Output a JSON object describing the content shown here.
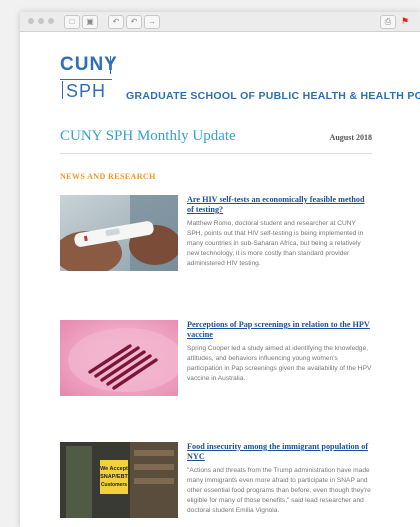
{
  "logo": {
    "line1": "CUNY",
    "line2": "SPH"
  },
  "school_name": "GRADUATE SCHOOL OF PUBLIC HEALTH & HEALTH POLICY",
  "newsletter": {
    "title": "CUNY SPH Monthly Update",
    "date": "August 2018"
  },
  "section_heading": "NEWS AND RESEARCH",
  "toolbar": {
    "icons": [
      "trash-icon",
      "archive-icon",
      "reply-icon",
      "reply-all-icon",
      "forward-icon",
      "print-icon",
      "flag-icon"
    ]
  },
  "articles": [
    {
      "title": "Are HIV self-tests an economically feasible method of testing?",
      "body": "Matthew Romo, doctoral student and researcher at CUNY SPH, points out that HIV self-testing is being implemented in many countries in sub-Saharan Africa, but being a relatively new technology, it is more costly than standard provider administered HIV testing."
    },
    {
      "title": "Perceptions of Pap screenings in relation to the HPV vaccine",
      "body": "Spring Cooper led a study aimed at identifying the knowledge, attitudes, and behaviors influencing young women's participation in Pap screenings given the availability of the HPV vaccine in Australia."
    },
    {
      "title": "Food insecurity among the immigrant population of NYC",
      "body": "\"Actions and threats from the Trump administration have made many immigrants even more afraid to participate in SNAP and other essential food programs than before, even though they're eligible for many of those benefits,\" said lead researcher and doctoral student Emilia Vignola.",
      "sign_text": "We Accept SNAP/EBT Customers"
    }
  ]
}
